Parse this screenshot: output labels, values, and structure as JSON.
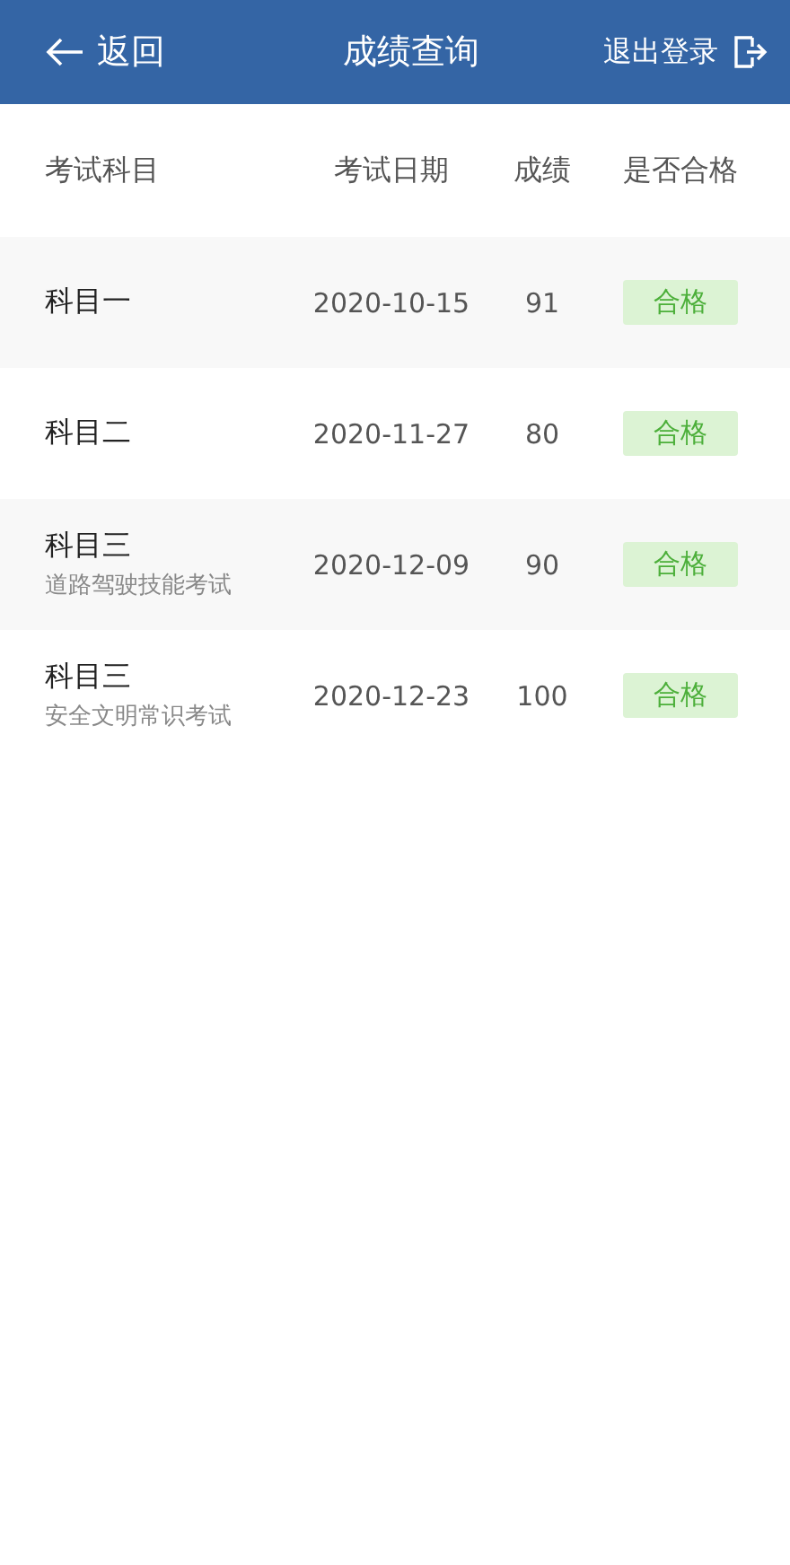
{
  "header": {
    "back": "返回",
    "title": "成绩查询",
    "logout": "退出登录"
  },
  "table": {
    "columns": [
      "考试科目",
      "考试日期",
      "成绩",
      "是否合格"
    ],
    "rows": [
      {
        "subject": "科目一",
        "date": "2020-10-15",
        "score": "91",
        "result": "合格",
        "passed": true
      },
      {
        "subject": "科目二",
        "date": "2020-11-27",
        "score": "80",
        "result": "合格",
        "passed": true
      },
      {
        "subject": "科目三",
        "note": "道路驾驶技能考试",
        "date": "2020-12-09",
        "score": "90",
        "result": "合格",
        "passed": true
      },
      {
        "subject": "科目三",
        "note": "安全文明常识考试",
        "date": "2020-12-23",
        "score": "100",
        "result": "合格",
        "passed": true
      }
    ]
  }
}
